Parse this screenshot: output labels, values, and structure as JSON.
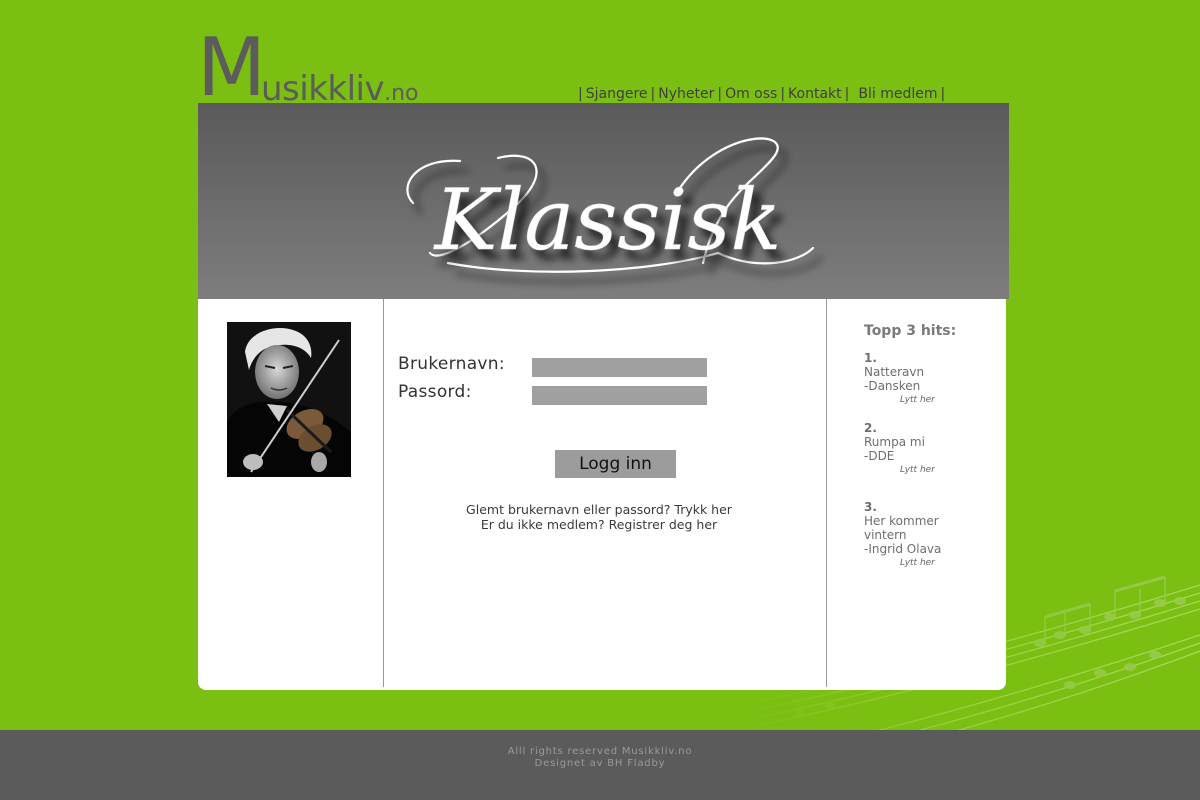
{
  "logo": {
    "initial": "M",
    "rest": "usikkliv",
    "tld": ".no"
  },
  "nav": {
    "separator": "|",
    "items": [
      "Sjangere",
      "Nyheter",
      "Om oss",
      "Kontakt",
      "Bli medlem"
    ]
  },
  "banner": {
    "title": "Klassisk"
  },
  "login": {
    "username_label": "Brukernavn:",
    "username_value": "",
    "password_label": "Passord:",
    "password_value": "",
    "button_label": "Logg inn",
    "forgot_text": "Glemt brukernavn eller passord? Trykk her",
    "register_text": "Er du ikke medlem? Registrer deg her"
  },
  "hits": {
    "title": "Topp 3 hits:",
    "items": [
      {
        "rank": "1.",
        "lines": [
          "Natteravn",
          "-Dansken"
        ],
        "listen": "Lytt her"
      },
      {
        "rank": "2.",
        "lines": [
          "Rumpa mi",
          "-DDE"
        ],
        "listen": "Lytt her"
      },
      {
        "rank": "3.",
        "lines": [
          "Her kommer",
          "vintern",
          "-Ingrid Olava"
        ],
        "listen": "Lytt her"
      }
    ]
  },
  "footer": {
    "line1": "Alll rights reserved Musikkliv.no",
    "line2": "Designet av BH Fladby"
  },
  "colors": {
    "background": "#7bbf12",
    "banner": "#6b6b6b",
    "panel": "#ffffff",
    "footer": "#5b5b5b",
    "input": "#a0a0a0",
    "button": "#9c9c9c"
  },
  "icons": {
    "photo": "violinist-photo",
    "watermark": "sheet-music-watermark"
  }
}
